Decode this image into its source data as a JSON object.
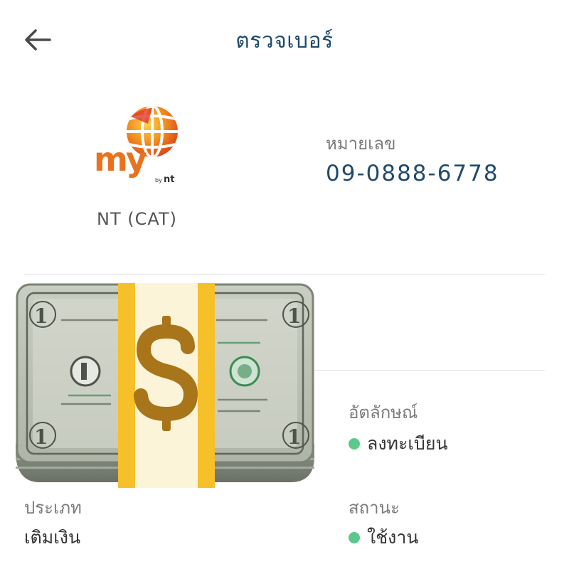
{
  "header": {
    "title": "ตรวจเบอร์",
    "back_icon": "arrow-left-icon"
  },
  "operator": {
    "logo_icon": "my-by-nt-logo",
    "name": "NT (CAT)"
  },
  "number": {
    "label": "หมายเลข",
    "value": "09-0888-6778"
  },
  "identity": {
    "label": "อัตลักษณ์",
    "value": "ลงทะเบียน"
  },
  "type": {
    "label": "ประเภท",
    "value": "เติมเงิน"
  },
  "state": {
    "label": "สถานะ",
    "value": "ใช้งาน"
  },
  "overlay": {
    "icon": "money-with-dollar-band-icon"
  },
  "colors": {
    "title": "#1f4a6e",
    "status_dot": "#5cc98c",
    "logo_orange": "#e8731f",
    "band_yellow": "#f5c02a"
  }
}
